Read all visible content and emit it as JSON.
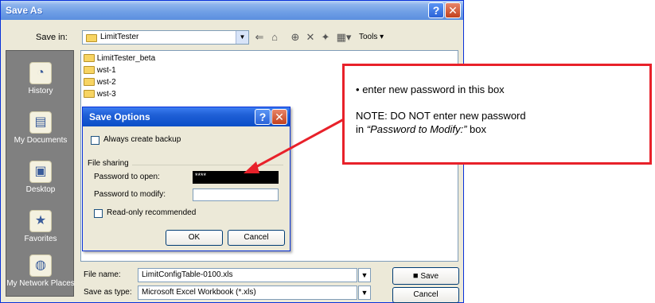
{
  "window": {
    "title": "Save As"
  },
  "toolbar": {
    "save_in_label": "Save in:",
    "save_in_value": "LimitTester",
    "tools_label": "Tools"
  },
  "places": [
    {
      "label": "History",
      "icon": "history-icon"
    },
    {
      "label": "My Documents",
      "icon": "my-documents-icon"
    },
    {
      "label": "Desktop",
      "icon": "desktop-icon"
    },
    {
      "label": "Favorites",
      "icon": "favorites-icon"
    },
    {
      "label": "My Network Places",
      "icon": "network-places-icon"
    }
  ],
  "files": [
    {
      "name": "LimitTester_beta"
    },
    {
      "name": "wst-1"
    },
    {
      "name": "wst-2"
    },
    {
      "name": "wst-3"
    }
  ],
  "footer": {
    "file_name_label": "File name:",
    "file_name_value": "LimitConfigTable-0100.xls",
    "save_type_label": "Save as type:",
    "save_type_value": "Microsoft Excel Workbook (*.xls)",
    "save_button": "Save",
    "cancel_button": "Cancel"
  },
  "save_options": {
    "title": "Save Options",
    "always_backup": "Always create backup",
    "file_sharing": "File sharing",
    "password_open_label": "Password to open:",
    "password_open_value": "****",
    "password_modify_label": "Password to modify:",
    "password_modify_value": "",
    "read_only": "Read-only recommended",
    "ok": "OK",
    "cancel": "Cancel"
  },
  "callout": {
    "line1": "enter new password in this box",
    "line2": "NOTE: DO NOT enter new password",
    "line3_prefix": "in ",
    "line3_emph": "“Password to Modify:”",
    "line3_suffix": " box",
    "border_color": "#e8212a"
  }
}
